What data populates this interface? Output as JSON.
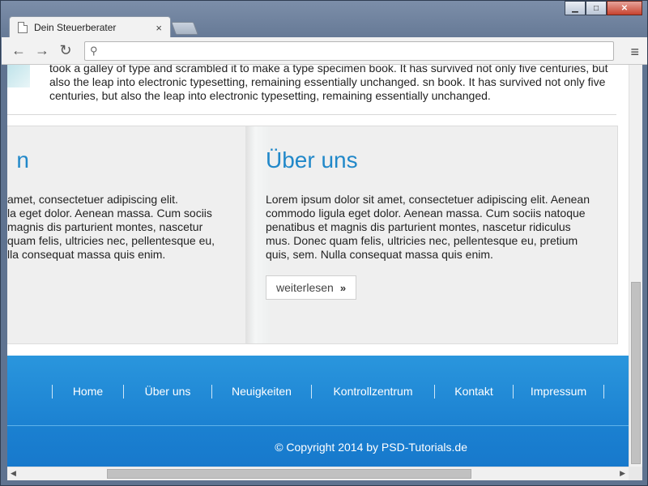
{
  "browser": {
    "tab_title": "Dein Steuerberater",
    "tab_close": "×",
    "address_value": "",
    "back": "←",
    "forward": "→",
    "reload": "↻",
    "menu": "≡",
    "min": "▁",
    "max": "□",
    "close": "✕"
  },
  "page": {
    "top_paragraph": "took a galley of type and scrambled it to make a type specimen book. It has survived not only five centuries, but also the leap into electronic typesetting, remaining essentially unchanged. sn book. It has survived not only five centuries, but also the leap into electronic typesetting, remaining essentially unchanged.",
    "left_col": {
      "heading": "n",
      "text": "amet, consectetuer adipiscing elit.\nla eget dolor. Aenean massa. Cum sociis\nmagnis dis parturient montes, nascetur\nquam felis, ultricies nec, pellentesque eu,\nlla consequat massa quis enim."
    },
    "right_col": {
      "heading": "Über uns",
      "text": "Lorem ipsum dolor sit amet, consectetuer adipiscing elit. Aenean commodo ligula eget dolor. Aenean massa. Cum sociis natoque penatibus et magnis dis parturient montes, nascetur ridiculus mus. Donec quam felis, ultricies nec, pellentesque eu, pretium quis, sem. Nulla consequat massa quis enim.",
      "readmore_label": "weiterlesen",
      "readmore_chevron": "»"
    }
  },
  "footer": {
    "nav": [
      {
        "label": "Home"
      },
      {
        "label": "Über uns"
      },
      {
        "label": "Neuigkeiten"
      },
      {
        "label": "Kontrollzentrum"
      },
      {
        "label": "Kontakt"
      },
      {
        "label": "Impressum"
      }
    ],
    "copyright": "© Copyright 2014 by PSD-Tutorials.de"
  },
  "colors": {
    "accent": "#2188c9",
    "footer_blue": "#1a7fd0"
  }
}
